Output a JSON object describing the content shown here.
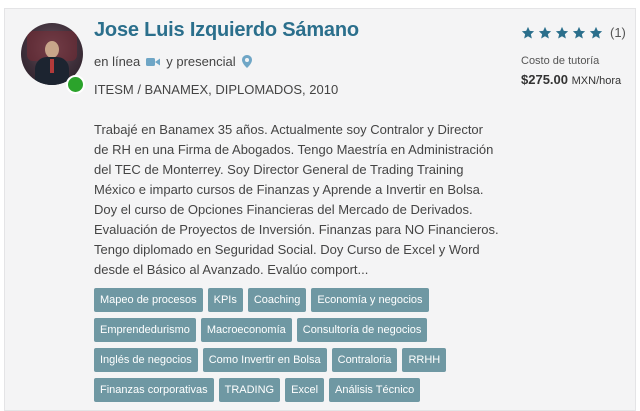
{
  "tutor": {
    "name": "Jose Luis Izquierdo Sámano",
    "online_label": "en línea",
    "in_person_label": "y presencial",
    "education": "ITESM / BANAMEX, DIPLOMADOS, 2010",
    "bio": "Trabajé en Banamex 35 años. Actualmente soy Contralor y Director de RH en una Firma de Abogados. Tengo Maestría en Administración del TEC de Monterrey. Soy Director General de Trading Training México e imparto cursos de Finanzas y Aprende a Invertir en Bolsa. Doy el curso de Opciones Financieras del Mercado de Derivados. Evaluación de Proyectos de Inversión. Finanzas para NO Financieros. Tengo diplomado en Seguridad Social. Doy Curso de Excel y Word desde el Básico al Avanzado. Evalúo comport..."
  },
  "rating": {
    "stars": 5,
    "count_label": "(1)",
    "star_color": "#2b6f8c"
  },
  "pricing": {
    "label": "Costo de tutoría",
    "amount": "$275.00",
    "unit": "MXN/hora"
  },
  "tags": [
    "Mapeo de procesos",
    "KPIs",
    "Coaching",
    "Economía y negocios",
    "Emprendedurismo",
    "Macroeconomía",
    "Consultoría de negocios",
    "Inglés de negocios",
    "Como Invertir en Bolsa",
    "Contraloria",
    "RRHH",
    "Finanzas corporativas",
    "TRADING",
    "Excel",
    "Análisis Técnico"
  ],
  "colors": {
    "name": "#2b6f8c",
    "tag_bg": "#6f98a3",
    "online_dot": "#2ba32b",
    "icon": "#6fa6c6"
  },
  "icons": {
    "online_mode": "video-camera-icon",
    "in_person_mode": "map-pin-icon",
    "status": "online-status-icon"
  }
}
